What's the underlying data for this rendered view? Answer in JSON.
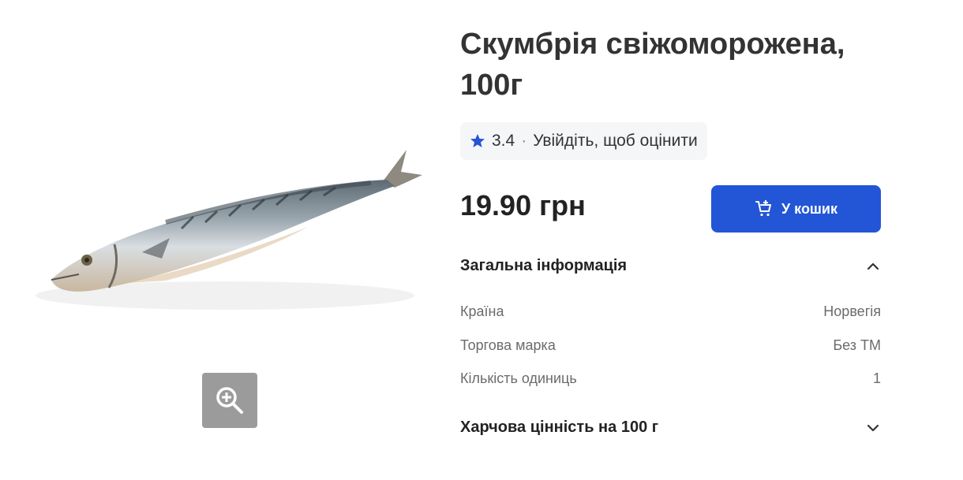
{
  "product": {
    "title": "Скумбрія свіжоморожена, 100г",
    "rating_value": "3.4",
    "rating_separator": "·",
    "rating_prompt": "Увійдіть, щоб оцінити",
    "price": "19.90 грн",
    "add_to_cart_label": "У кошик",
    "image_icon": "fish-photo",
    "zoom_icon": "zoom-in-icon"
  },
  "general_info": {
    "heading": "Загальна інформація",
    "expanded": true,
    "rows": [
      {
        "label": "Країна",
        "value": "Норвегія"
      },
      {
        "label": "Торгова марка",
        "value": "Без ТМ"
      },
      {
        "label": "Кількість одиниць",
        "value": "1"
      }
    ]
  },
  "nutrition": {
    "heading": "Харчова цінність на 100 г",
    "expanded": false
  },
  "colors": {
    "accent": "#2356d6",
    "star": "#2356d6",
    "zoom_bg": "#9b9b9b",
    "rating_bg": "#f5f6f8"
  }
}
